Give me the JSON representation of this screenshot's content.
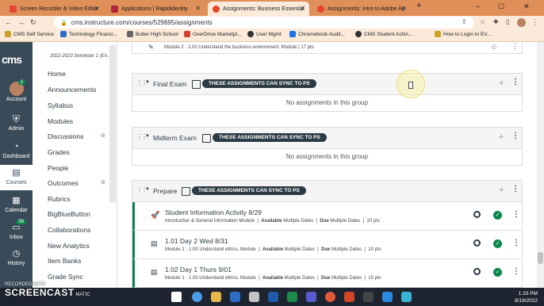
{
  "browser": {
    "tabs": [
      {
        "label": "Screen Recorder & Video Editor",
        "color": "#e7453a"
      },
      {
        "label": "Applications | Rapididentity",
        "color": "#b0263b"
      },
      {
        "label": "Assignments: Business Essential",
        "color": "#e3452b"
      },
      {
        "label": "Assignments: Intro to Adobe Ap",
        "color": "#e3452b"
      }
    ],
    "new_tab": "+",
    "url": "cms.instructure.com/courses/529695/assignments",
    "bookmarks": [
      "CMS Self Service",
      "Technology Financi...",
      "Butler High School",
      "OverDrive Marketpl...",
      "User Mgmt",
      "Chromebook Audit...",
      "CMS Student Activi...",
      "How to Login to EV..."
    ]
  },
  "global_nav": {
    "logo": "cms",
    "items": [
      {
        "label": "Account",
        "badge": "2"
      },
      {
        "label": "Admin"
      },
      {
        "label": "Dashboard"
      },
      {
        "label": "Courses",
        "selected": true
      },
      {
        "label": "Calendar"
      },
      {
        "label": "Inbox",
        "badge": "59"
      },
      {
        "label": "History"
      }
    ]
  },
  "course_nav": {
    "term": "2022-2023 Semester 1 (En...",
    "links": [
      "Home",
      "Announcements",
      "Syllabus",
      "Modules",
      "Discussions",
      "Grades",
      "People",
      "Outcomes",
      "Rubrics",
      "BigBlueButton",
      "Collaborations",
      "New Analytics",
      "Item Banks",
      "Grade Sync"
    ],
    "hidden_links": [
      "Discussions",
      "Outcomes"
    ]
  },
  "main": {
    "top_item_meta": "Module 2 · 2.00 Understand the business environment. Module  |  17 pts",
    "groups": [
      {
        "title": "Final Exam",
        "badge": "THESE ASSIGNMENTS CAN SYNC TO PS",
        "empty": "No assignments in this group"
      },
      {
        "title": "Midterm Exam",
        "badge": "THESE ASSIGNMENTS CAN SYNC TO PS",
        "empty": "No assignments in this group"
      },
      {
        "title": "Prepare",
        "badge": "THESE ASSIGNMENTS CAN SYNC TO PS",
        "assignments": [
          {
            "title": "Student Information Activity 8/29",
            "module": "Introduction & General Information Module",
            "available": "Available",
            "avail_val": "Multiple Dates",
            "due": "Due",
            "due_val": "Multiple Dates",
            "points": "20 pts"
          },
          {
            "title": "1.01 Day 2 Wed 8/31",
            "module": "Module 1 · 1.00 Understand ethics. Module",
            "available": "Available",
            "avail_val": "Multiple Dates",
            "due": "Due",
            "due_val": "Multiple Dates",
            "points": "10 pts"
          },
          {
            "title": "1.02 Day 1 Thurs 9/01",
            "module": "Module 1 · 1.00 Understand ethics. Module",
            "available": "Available",
            "avail_val": "Multiple Dates",
            "due": "Due",
            "due_val": "Multiple Dates",
            "points": "15 pts"
          }
        ]
      }
    ]
  },
  "taskbar": {
    "time": "1:33 PM",
    "date": "8/19/2022"
  },
  "watermark": {
    "top": "RECORDED WITH",
    "brand": "SCREENCAST",
    "suffix": "MATIC"
  }
}
